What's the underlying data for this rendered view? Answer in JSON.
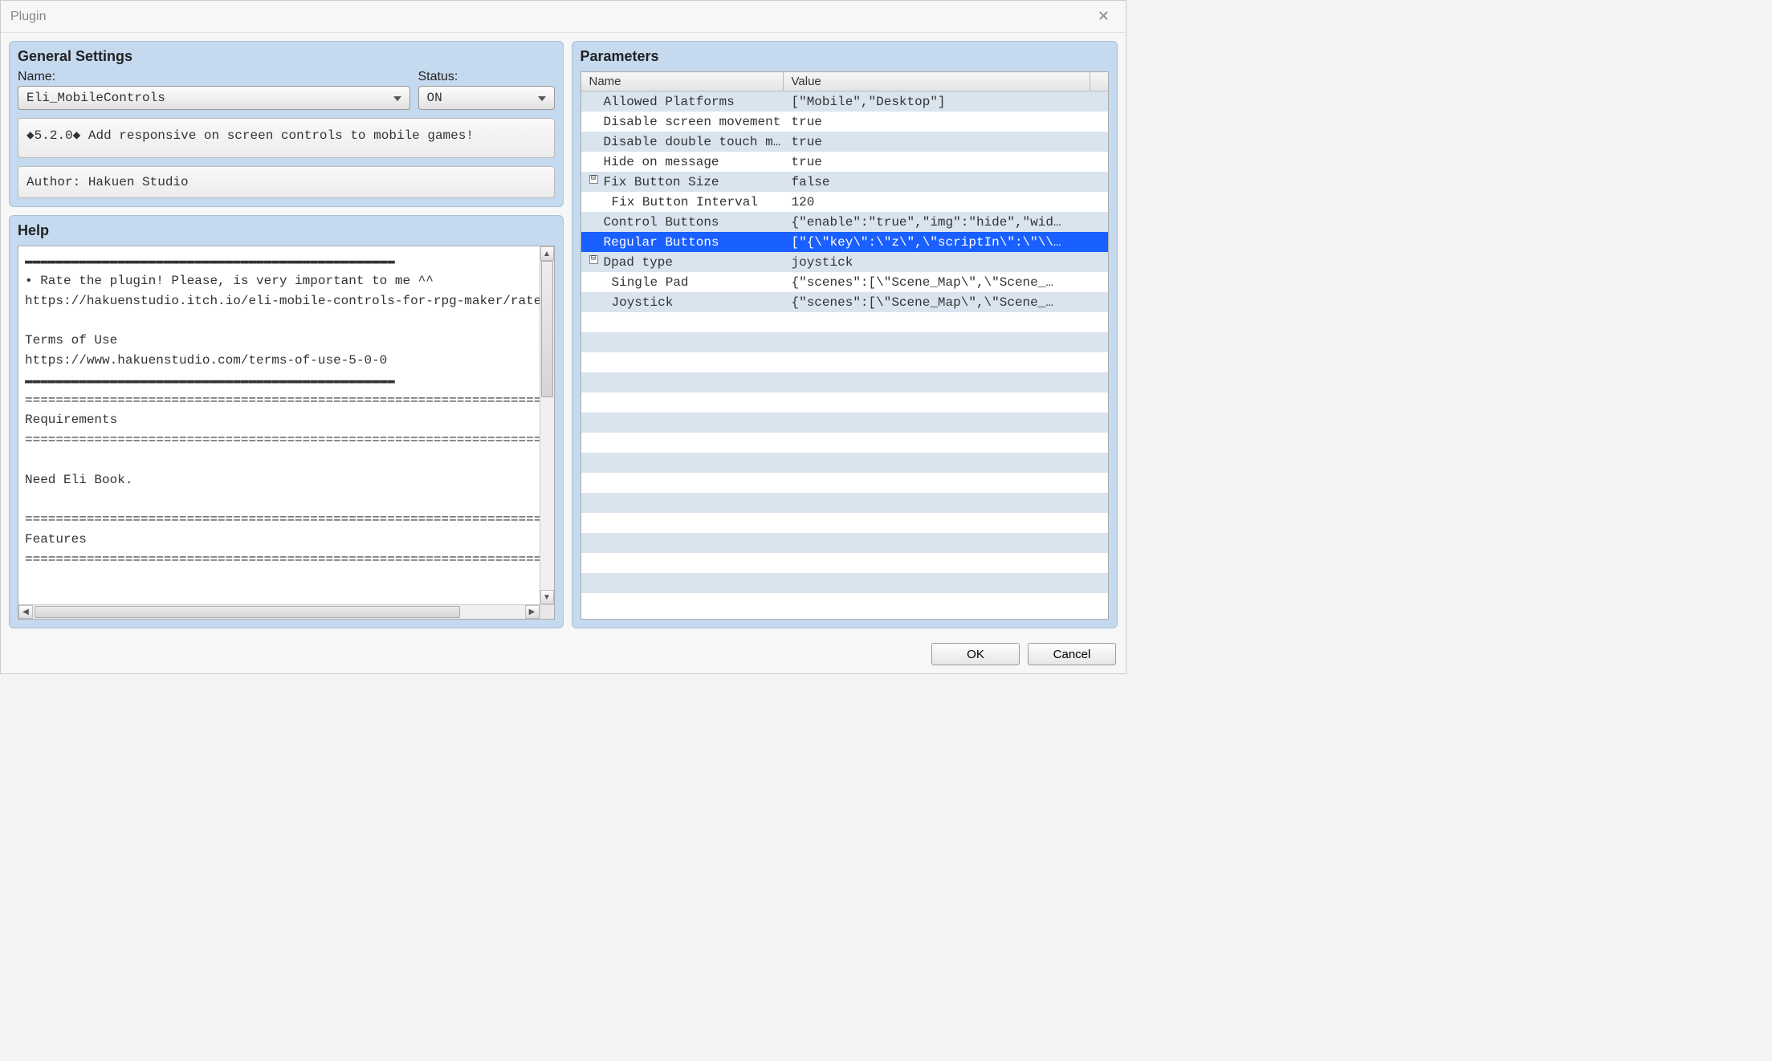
{
  "window": {
    "title": "Plugin"
  },
  "general": {
    "title": "General Settings",
    "name_label": "Name:",
    "name_value": "Eli_MobileControls",
    "status_label": "Status:",
    "status_value": "ON",
    "description": "◆5.2.0◆ Add responsive on screen controls to mobile games!",
    "author": "Author: Hakuen Studio"
  },
  "help": {
    "title": "Help",
    "text": "▬▬▬▬▬▬▬▬▬▬▬▬▬▬▬▬▬▬▬▬▬▬▬▬▬▬▬▬▬▬▬▬▬▬▬▬▬▬▬▬▬▬▬▬▬▬▬▬\n• Rate the plugin! Please, is very important to me ^^\nhttps://hakuenstudio.itch.io/eli-mobile-controls-for-rpg-maker/rate?source=game\n\nTerms of Use\nhttps://www.hakuenstudio.com/terms-of-use-5-0-0\n▬▬▬▬▬▬▬▬▬▬▬▬▬▬▬▬▬▬▬▬▬▬▬▬▬▬▬▬▬▬▬▬▬▬▬▬▬▬▬▬▬▬▬▬▬▬▬▬\n============================================================================\nRequirements\n============================================================================\n\nNeed Eli Book.\n\n============================================================================\nFeatures\n============================================================================"
  },
  "parameters": {
    "title": "Parameters",
    "header_name": "Name",
    "header_value": "Value",
    "selected_index": 7,
    "rows": [
      {
        "name": "Allowed Platforms",
        "value": "[\"Mobile\",\"Desktop\"]",
        "indent": 1,
        "toggle": null
      },
      {
        "name": "Disable screen movement",
        "value": "true",
        "indent": 1,
        "toggle": null
      },
      {
        "name": "Disable double touch menu",
        "value": "true",
        "indent": 1,
        "toggle": null
      },
      {
        "name": "Hide on message",
        "value": "true",
        "indent": 1,
        "toggle": null
      },
      {
        "name": "Fix Button Size",
        "value": "false",
        "indent": 0,
        "toggle": "minus"
      },
      {
        "name": "Fix Button Interval",
        "value": "120",
        "indent": 2,
        "toggle": null
      },
      {
        "name": "Control Buttons",
        "value": "{\"enable\":\"true\",\"img\":\"hide\",\"wid…",
        "indent": 1,
        "toggle": null
      },
      {
        "name": "Regular Buttons",
        "value": "[\"{\\\"key\\\":\\\"z\\\",\\\"scriptIn\\\":\\\"\\\\…",
        "indent": 1,
        "toggle": null
      },
      {
        "name": "Dpad type",
        "value": "joystick",
        "indent": 0,
        "toggle": "minus"
      },
      {
        "name": "Single Pad",
        "value": "{\"scenes\":[\\\"Scene_Map\\\",\\\"Scene_…",
        "indent": 2,
        "toggle": null
      },
      {
        "name": "Joystick",
        "value": "{\"scenes\":[\\\"Scene_Map\\\",\\\"Scene_…",
        "indent": 2,
        "toggle": null
      }
    ],
    "blank_rows": 14
  },
  "buttons": {
    "ok": "OK",
    "cancel": "Cancel"
  }
}
